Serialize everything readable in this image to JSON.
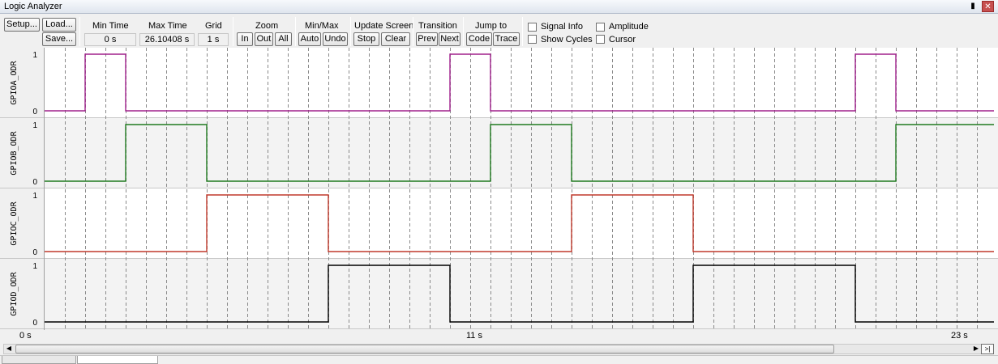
{
  "window": {
    "title": "Logic Analyzer"
  },
  "toolbar": {
    "setup_label": "Setup...",
    "load_label": "Load...",
    "save_label": "Save...",
    "min_time": {
      "label": "Min Time",
      "value": "0 s"
    },
    "max_time": {
      "label": "Max Time",
      "value": "26.10408 s"
    },
    "grid": {
      "label": "Grid",
      "value": "1 s"
    },
    "zoom": {
      "label": "Zoom",
      "in": "In",
      "out": "Out",
      "all": "All"
    },
    "minmax": {
      "label": "Min/Max",
      "auto": "Auto",
      "undo": "Undo"
    },
    "update_screen": {
      "label": "Update Screen",
      "stop": "Stop",
      "clear": "Clear"
    },
    "transition": {
      "label": "Transition",
      "prev": "Prev",
      "next": "Next"
    },
    "jump_to": {
      "label": "Jump to",
      "code": "Code",
      "trace": "Trace"
    },
    "checkboxes": {
      "signal_info": "Signal Info",
      "show_cycles": "Show Cycles",
      "amplitude": "Amplitude",
      "cursor": "Cursor"
    }
  },
  "signals": [
    {
      "name": "GPIOA_ODR",
      "color": "#a0208c",
      "high": "1",
      "low": "0",
      "transitions": [
        [
          0,
          0
        ],
        [
          2,
          1
        ],
        [
          4,
          0
        ],
        [
          20,
          1
        ],
        [
          22,
          0
        ],
        [
          40,
          1
        ],
        [
          42,
          0
        ]
      ]
    },
    {
      "name": "GPIOB_ODR",
      "color": "#1f7a1f",
      "high": "1",
      "low": "0",
      "transitions": [
        [
          0,
          0
        ],
        [
          4,
          1
        ],
        [
          8,
          0
        ],
        [
          22,
          1
        ],
        [
          26,
          0
        ],
        [
          42,
          1
        ]
      ]
    },
    {
      "name": "GPIOC_ODR",
      "color": "#c0392b",
      "high": "1",
      "low": "0",
      "transitions": [
        [
          0,
          0
        ],
        [
          8,
          1
        ],
        [
          14,
          0
        ],
        [
          26,
          1
        ],
        [
          32,
          0
        ]
      ]
    },
    {
      "name": "GPIOD_ODR",
      "color": "#000000",
      "high": "1",
      "low": "0",
      "transitions": [
        [
          0,
          0
        ],
        [
          14,
          1
        ],
        [
          20,
          0
        ],
        [
          32,
          1
        ],
        [
          40,
          0
        ]
      ]
    }
  ],
  "time_axis": {
    "left": "0 s",
    "middle": "11 s",
    "right": "23 s"
  },
  "scroll": {
    "end_label": ">|"
  }
}
